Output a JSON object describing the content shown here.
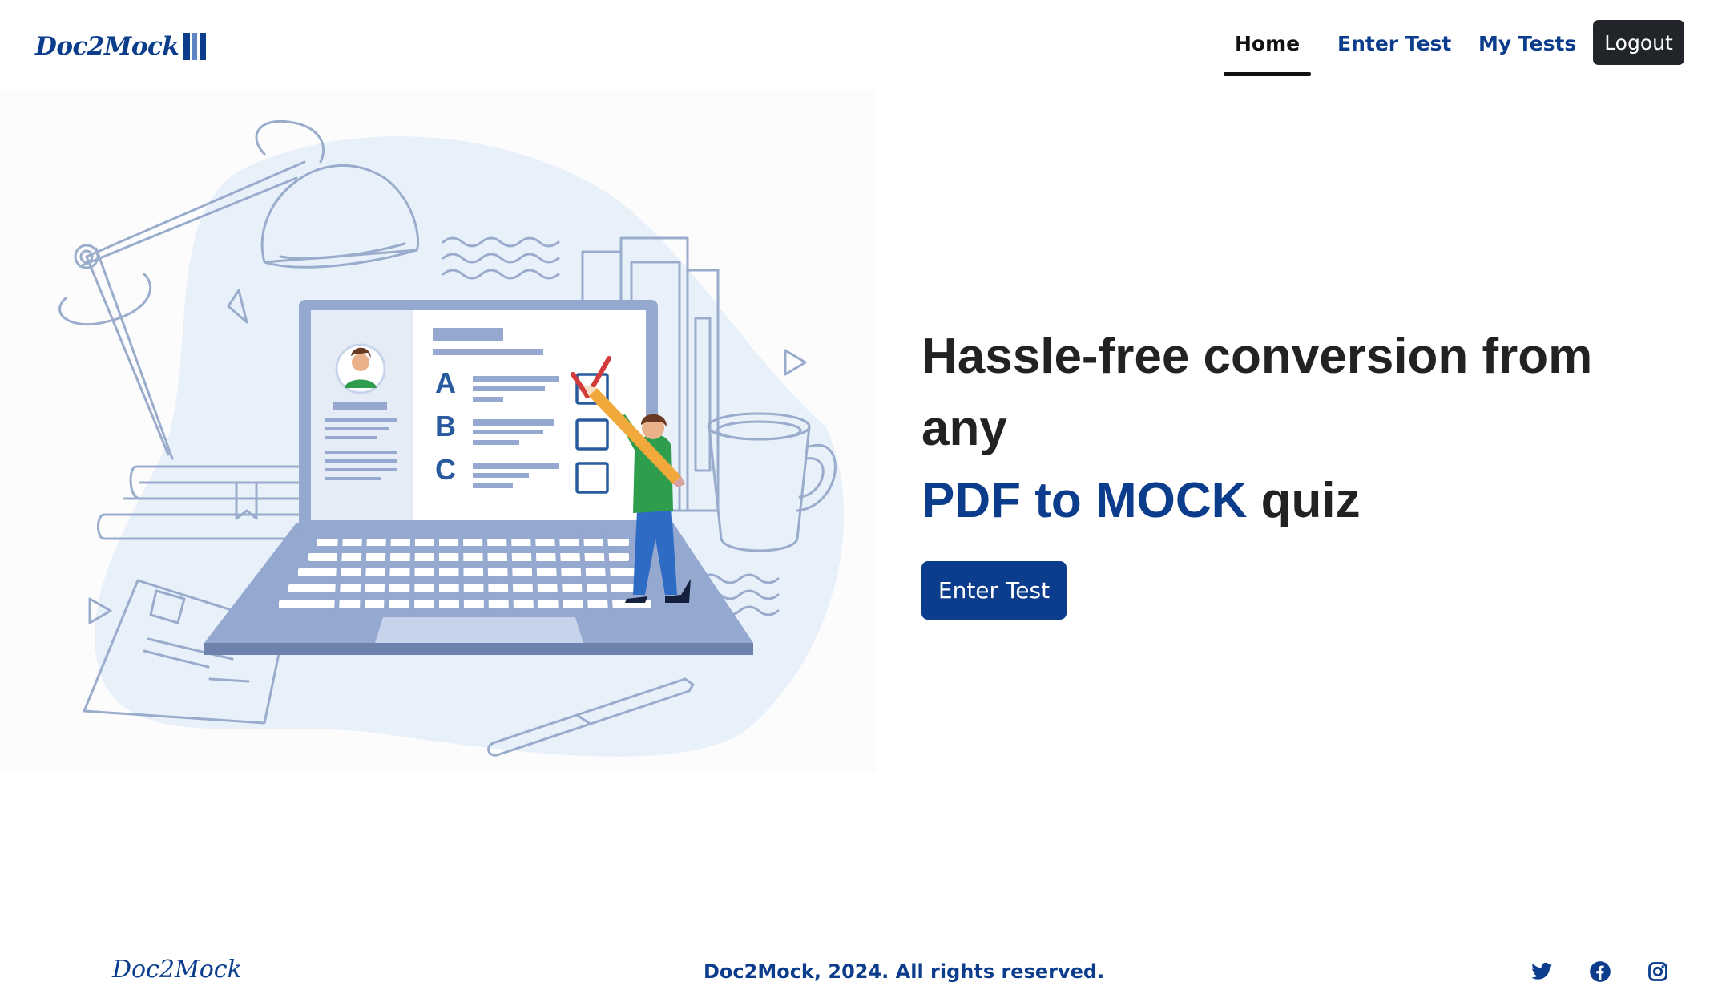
{
  "nav": {
    "brand": "Doc2Mock",
    "links": [
      {
        "label": "Home",
        "active": true
      },
      {
        "label": "Enter Test",
        "active": false
      },
      {
        "label": "My Tests",
        "active": false
      }
    ],
    "logout_label": "Logout"
  },
  "hero": {
    "headline_line1": "Hassle-free conversion from any",
    "headline_accent": "PDF to MOCK",
    "headline_rest": " quiz",
    "cta_label": "Enter Test",
    "illustration": {
      "options": [
        "A",
        "B",
        "C"
      ]
    }
  },
  "footer": {
    "brand": "Doc2Mock",
    "copyright": "Doc2Mock, 2024. All rights reserved.",
    "social_icons": [
      "twitter-icon",
      "facebook-icon",
      "instagram-icon"
    ]
  },
  "colors": {
    "brand": "#0b3d8c",
    "dark": "#212529",
    "text": "#222222",
    "illustration_line": "#9aaccc",
    "illustration_fill": "#e8f0fa"
  }
}
